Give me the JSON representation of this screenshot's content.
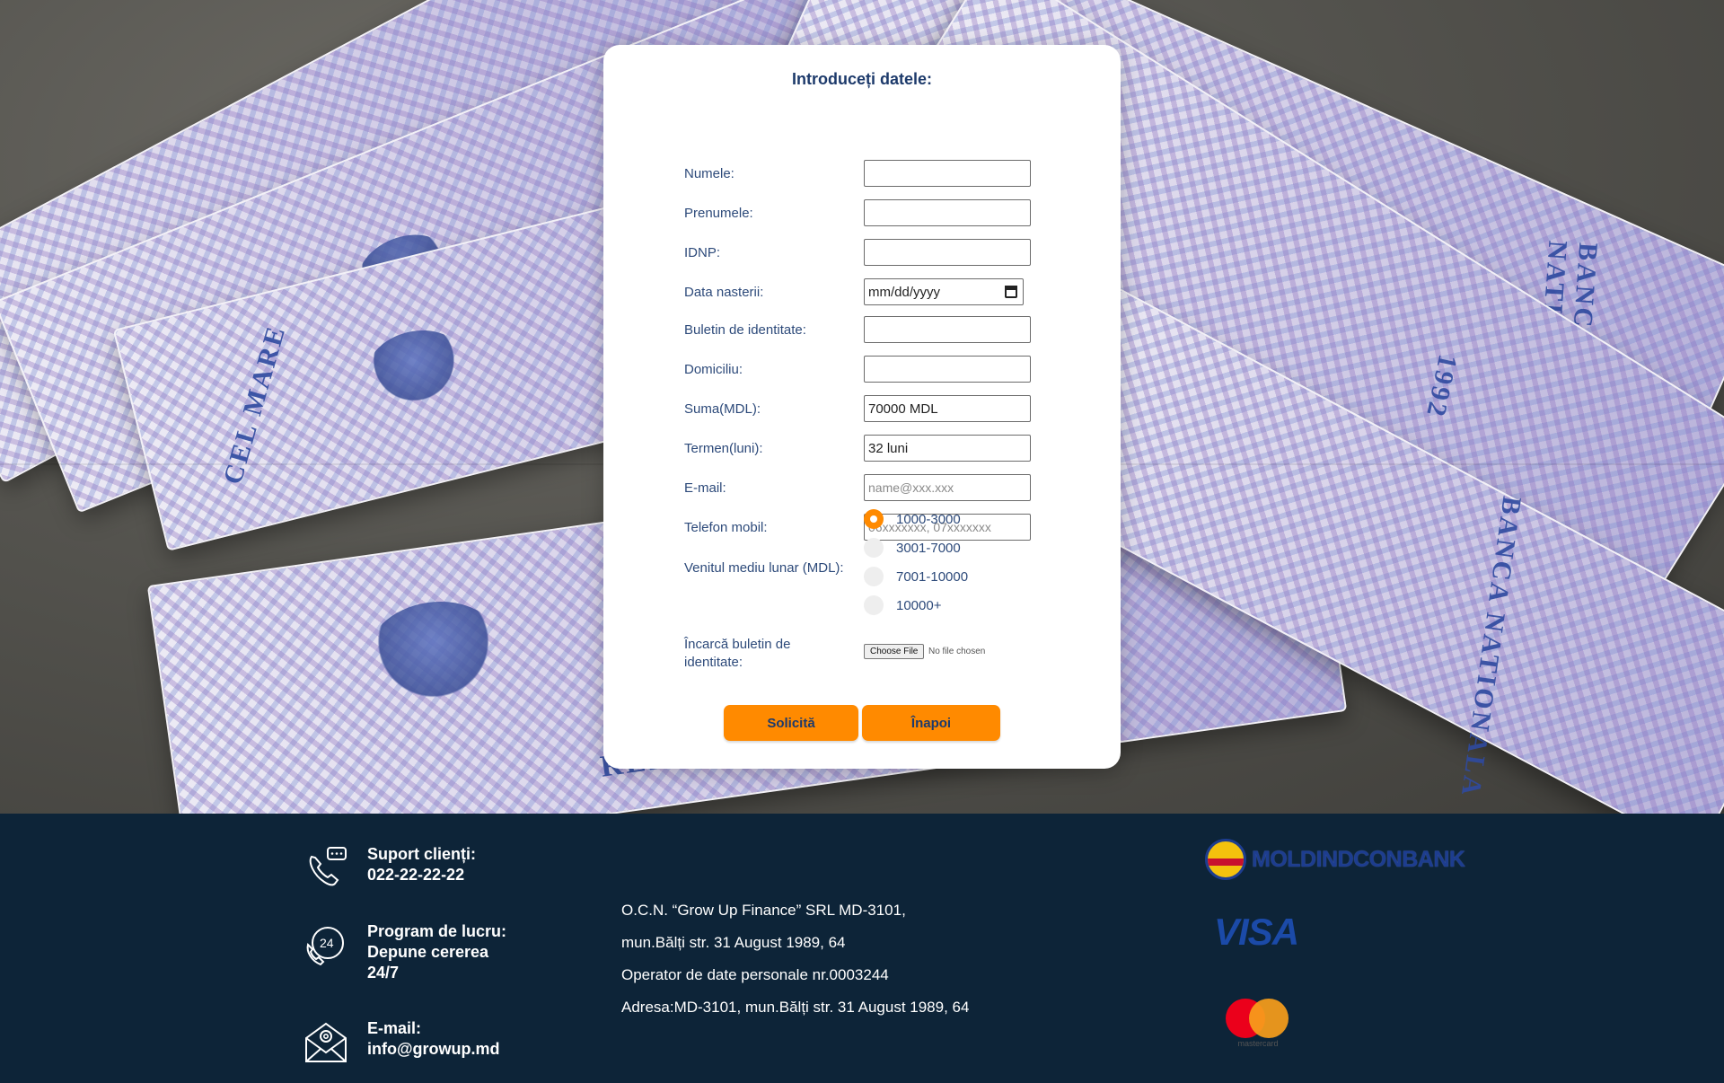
{
  "form": {
    "title": "Introduceți datele:",
    "fields": [
      {
        "label": "Numele:",
        "value": "",
        "placeholder": ""
      },
      {
        "label": "Prenumele:",
        "value": "",
        "placeholder": ""
      },
      {
        "label": "IDNP:",
        "value": "",
        "placeholder": ""
      },
      {
        "label": "Data nasterii:",
        "value": "mm/dd/yyyy",
        "placeholder": ""
      },
      {
        "label": "Buletin de identitate:",
        "value": "",
        "placeholder": ""
      },
      {
        "label": "Domiciliu:",
        "value": "",
        "placeholder": ""
      },
      {
        "label": "Suma(MDL):",
        "value": "70000 MDL",
        "placeholder": ""
      },
      {
        "label": "Termen(luni):",
        "value": "32 luni",
        "placeholder": ""
      },
      {
        "label": "E-mail:",
        "value": "",
        "placeholder": "name@xxx.xxx"
      },
      {
        "label": "Telefon mobil:",
        "value": "",
        "placeholder": "06xxxxxxx, 07xxxxxxx"
      }
    ],
    "income": {
      "label": "Venitul mediu lunar (MDL):",
      "options": [
        "1000-3000",
        "3001-7000",
        "7001-10000",
        "10000+"
      ],
      "selected": "1000-3000"
    },
    "upload": {
      "label": "Încarcă buletin de identitate:",
      "button": "Choose File",
      "status": "No file chosen"
    },
    "buttons": {
      "submit": "Solicită",
      "back": "Înapoi"
    }
  },
  "footer": {
    "support": {
      "title": "Suport clienți:",
      "value": "022-22-22-22"
    },
    "program": {
      "title": "Program de lucru:",
      "line1": "Depune cererea",
      "line2": "24/7"
    },
    "email": {
      "title": "E-mail:",
      "value": "info@growup.md"
    },
    "address": [
      "O.C.N. “Grow Up Finance” SRL MD-3101,",
      "mun.Bălți str. 31 August 1989, 64",
      "Operator de date personale nr.0003244",
      "Adresa:MD-3101, mun.Bălți str. 31 August 1989, 64"
    ],
    "logos": {
      "bank": "MOLDINDCONBANK",
      "visa": "VISA",
      "mastercard": "mastercard"
    }
  },
  "colors": {
    "accent": "#ff8a00",
    "footer_bg": "#0d2438",
    "label": "#2d4a7a",
    "title": "#1d3a6b"
  }
}
